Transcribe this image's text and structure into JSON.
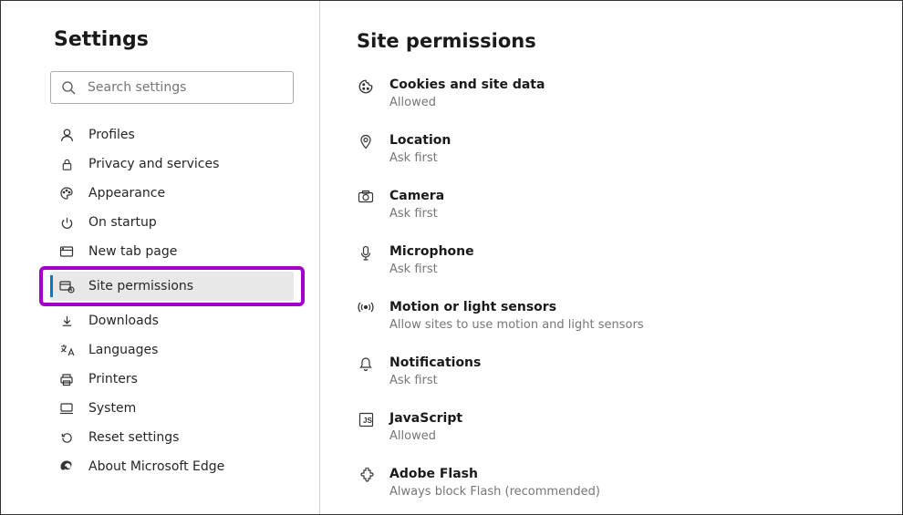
{
  "sidebar": {
    "title": "Settings",
    "search_placeholder": "Search settings",
    "items": [
      {
        "label": "Profiles"
      },
      {
        "label": "Privacy and services"
      },
      {
        "label": "Appearance"
      },
      {
        "label": "On startup"
      },
      {
        "label": "New tab page"
      },
      {
        "label": "Site permissions"
      },
      {
        "label": "Downloads"
      },
      {
        "label": "Languages"
      },
      {
        "label": "Printers"
      },
      {
        "label": "System"
      },
      {
        "label": "Reset settings"
      },
      {
        "label": "About Microsoft Edge"
      }
    ]
  },
  "main": {
    "title": "Site permissions",
    "permissions": [
      {
        "title": "Cookies and site data",
        "subtitle": "Allowed"
      },
      {
        "title": "Location",
        "subtitle": "Ask first"
      },
      {
        "title": "Camera",
        "subtitle": "Ask first"
      },
      {
        "title": "Microphone",
        "subtitle": "Ask first"
      },
      {
        "title": "Motion or light sensors",
        "subtitle": "Allow sites to use motion and light sensors"
      },
      {
        "title": "Notifications",
        "subtitle": "Ask first"
      },
      {
        "title": "JavaScript",
        "subtitle": "Allowed"
      },
      {
        "title": "Adobe Flash",
        "subtitle": "Always block Flash (recommended)"
      }
    ]
  }
}
